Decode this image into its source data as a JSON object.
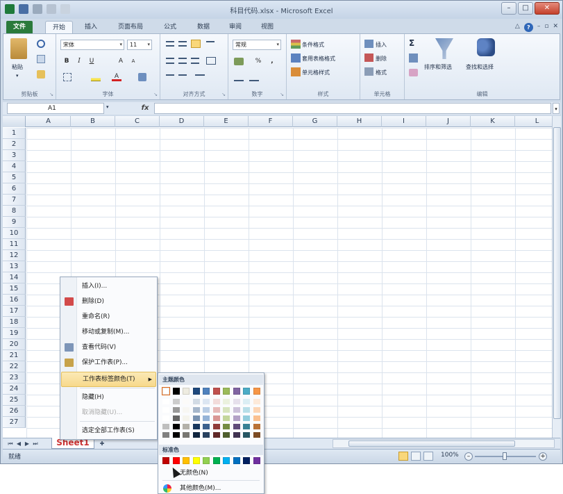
{
  "window": {
    "title": "科目代码.xlsx - Microsoft Excel"
  },
  "tabs": [
    {
      "label": "文件",
      "key": "file"
    },
    {
      "label": "开始",
      "key": "home"
    },
    {
      "label": "插入",
      "key": "insert"
    },
    {
      "label": "页面布局",
      "key": "layout"
    },
    {
      "label": "公式",
      "key": "formulas"
    },
    {
      "label": "数据",
      "key": "data"
    },
    {
      "label": "审阅",
      "key": "review"
    },
    {
      "label": "视图",
      "key": "view"
    }
  ],
  "ribbon": {
    "clipboard": {
      "label": "剪贴板",
      "paste": "粘贴"
    },
    "font": {
      "label": "字体",
      "font_name": "宋体",
      "font_size": "11",
      "bold": "B",
      "italic": "I",
      "underline": "U"
    },
    "alignment": {
      "label": "对齐方式"
    },
    "number": {
      "label": "数字",
      "format": "常规",
      "percent": "%",
      "comma": ","
    },
    "styles": {
      "label": "样式",
      "conditional": "条件格式",
      "table": "套用表格格式",
      "cell_styles": "单元格样式"
    },
    "cells": {
      "label": "单元格",
      "insert": "插入",
      "delete": "删除",
      "format": "格式"
    },
    "editing": {
      "label": "编辑",
      "sum": "Σ",
      "sort": "排序和筛选",
      "find": "查找和选择"
    }
  },
  "formula_bar": {
    "name_box": "A1",
    "fx": "fx"
  },
  "columns": [
    "A",
    "B",
    "C",
    "D",
    "E",
    "F",
    "G",
    "H",
    "I",
    "J",
    "K",
    "L"
  ],
  "rows": [
    "1",
    "2",
    "3",
    "4",
    "5",
    "6",
    "7",
    "8",
    "9",
    "10",
    "11",
    "12",
    "13",
    "14",
    "15",
    "16",
    "17",
    "18",
    "19",
    "20",
    "21",
    "22",
    "23",
    "24",
    "25",
    "26",
    "27"
  ],
  "sheet_tab": {
    "label": "Sheet1"
  },
  "status": {
    "ready": "就绪",
    "zoom": "100%"
  },
  "context_menu": {
    "items": [
      {
        "label": "插入(I)...",
        "key": "insert",
        "disabled": false
      },
      {
        "label": "删除(D)",
        "key": "delete",
        "disabled": false
      },
      {
        "label": "重命名(R)",
        "key": "rename",
        "disabled": false
      },
      {
        "label": "移动或复制(M)...",
        "key": "move",
        "disabled": false
      },
      {
        "label": "查看代码(V)",
        "key": "view-code",
        "disabled": false
      },
      {
        "label": "保护工作表(P)...",
        "key": "protect",
        "disabled": false
      },
      {
        "label": "工作表标签颜色(T)",
        "key": "tab-color",
        "disabled": false,
        "highlighted": true
      },
      {
        "label": "隐藏(H)",
        "key": "hide",
        "disabled": false
      },
      {
        "label": "取消隐藏(U)...",
        "key": "unhide",
        "disabled": true
      },
      {
        "label": "选定全部工作表(S)",
        "key": "select-all",
        "disabled": false
      }
    ]
  },
  "color_palette": {
    "theme_header": "主题颜色",
    "standard_header": "标准色",
    "no_color": "无颜色(N)",
    "more_colors": "其他颜色(M)...",
    "theme_colors": [
      "#ffffff",
      "#000000",
      "#eeece1",
      "#1f497d",
      "#4f81bd",
      "#c0504d",
      "#9bbb59",
      "#8064a2",
      "#4bacc6",
      "#f79646"
    ],
    "standard_colors": [
      "#c00000",
      "#ff0000",
      "#ffc000",
      "#ffff00",
      "#92d050",
      "#00b050",
      "#00b0f0",
      "#0070c0",
      "#002060",
      "#7030a0"
    ]
  }
}
